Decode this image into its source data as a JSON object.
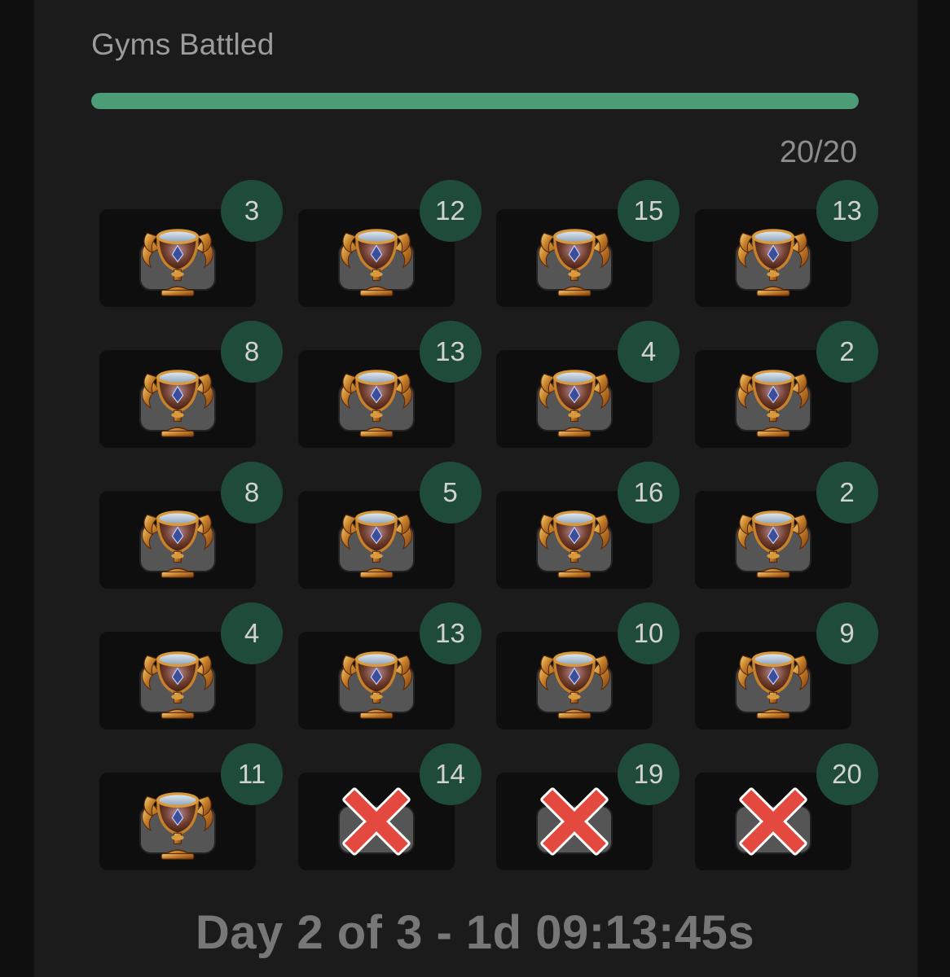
{
  "header": {
    "title": "Gyms Battled",
    "progress_label": "20/20",
    "progress_fraction": 1.0,
    "progress_color": "#4d9c78"
  },
  "gyms": [
    {
      "count": "3",
      "result": "trophy"
    },
    {
      "count": "12",
      "result": "trophy"
    },
    {
      "count": "15",
      "result": "trophy"
    },
    {
      "count": "13",
      "result": "trophy"
    },
    {
      "count": "8",
      "result": "trophy"
    },
    {
      "count": "13",
      "result": "trophy"
    },
    {
      "count": "4",
      "result": "trophy"
    },
    {
      "count": "2",
      "result": "trophy"
    },
    {
      "count": "8",
      "result": "trophy"
    },
    {
      "count": "5",
      "result": "trophy"
    },
    {
      "count": "16",
      "result": "trophy"
    },
    {
      "count": "2",
      "result": "trophy"
    },
    {
      "count": "4",
      "result": "trophy"
    },
    {
      "count": "13",
      "result": "trophy"
    },
    {
      "count": "10",
      "result": "trophy"
    },
    {
      "count": "9",
      "result": "trophy"
    },
    {
      "count": "11",
      "result": "trophy"
    },
    {
      "count": "14",
      "result": "failed"
    },
    {
      "count": "19",
      "result": "failed"
    },
    {
      "count": "20",
      "result": "failed"
    }
  ],
  "icons": {
    "trophy": "gold-trophy-icon",
    "failed": "red-x-icon"
  },
  "colors": {
    "badge_bg": "#1f4c3a",
    "fail_red": "#e3493f"
  },
  "footer": {
    "text": "Day 2 of 3 - 1d 09:13:45s"
  }
}
